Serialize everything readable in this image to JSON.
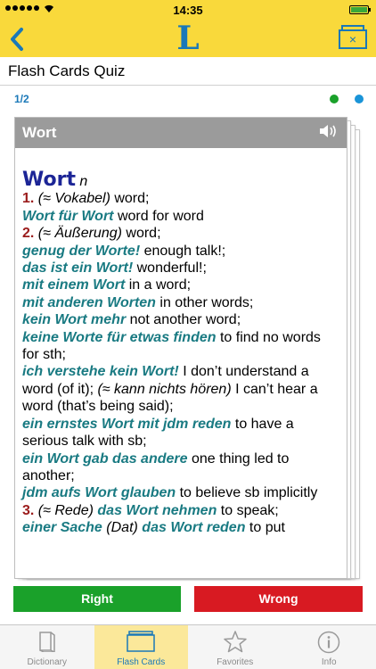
{
  "status": {
    "time": "14:35",
    "wifi_icon": "wifi-icon"
  },
  "nav": {
    "back_icon": "back-chevron-icon",
    "logo": "L",
    "card_icon": "flashcard-box-icon",
    "card_glyph": "×"
  },
  "title": "Flash Cards Quiz",
  "pager": {
    "label": "1/2",
    "dot_colors": [
      "#1aa12a",
      "#1a94d8"
    ]
  },
  "card": {
    "header_word": "Wort",
    "speaker_icon": "speaker-icon",
    "speaker_glyph": "🔊",
    "entry": {
      "headword": "Wort",
      "pos": "n",
      "s1_num": "1.",
      "s1_label": "(≈ Vokabel)",
      "s1_trans": " word;",
      "p1": "Wort für Wort",
      "p1_trans": " word for word",
      "s2_num": "2.",
      "s2_label": "(≈ Äußerung)",
      "s2_trans": " word;",
      "p2": "genug der Worte!",
      "p2_trans": " enough talk!;",
      "p3": "das ist ein Wort!",
      "p3_trans": " wonderful!;",
      "p4": "mit einem Wort",
      "p4_trans": " in a word;",
      "p5": "mit anderen Worten",
      "p5_trans": " in other words;",
      "p6": "kein Wort mehr",
      "p6_trans": " not another word;",
      "p7": "keine Worte für etwas finden",
      "p7_trans": " to find no words for sth;",
      "p8": "ich verstehe kein Wort!",
      "p8_trans": " I don’t understand a word (of it); ",
      "p8_label": "(≈ kann nichts hören)",
      "p8_trans2": " I can’t hear a word (that’s being said);",
      "p9": "ein ernstes Wort mit jdm reden",
      "p9_trans": " to have a serious talk with sb;",
      "p10": "ein Wort gab das andere",
      "p10_trans": " one thing led to another;",
      "p11": "jdm aufs Wort glauben",
      "p11_trans": " to believe sb implicitly",
      "s3_num": "3.",
      "s3_label": "(≈ Rede)",
      "p12": "das Wort nehmen",
      "p12_trans": " to speak;",
      "p13": "einer Sache",
      "p13_label": "(Dat)",
      "p14": "das Wort reden",
      "p14_trans": " to put"
    }
  },
  "buttons": {
    "right": "Right",
    "wrong": "Wrong"
  },
  "tabs": [
    {
      "label": "Dictionary",
      "icon": "dictionary-book-icon"
    },
    {
      "label": "Flash Cards",
      "icon": "flash-cards-icon"
    },
    {
      "label": "Favorites",
      "icon": "star-icon"
    },
    {
      "label": "Info",
      "icon": "info-icon"
    }
  ],
  "colors": {
    "brand_yellow": "#f9d93b",
    "accent_blue": "#1a78b8",
    "right_green": "#1aa12a",
    "wrong_red": "#d81a22",
    "phrase_teal": "#197a82",
    "headword_navy": "#1c2596",
    "sense_number_red": "#9b1c1c"
  }
}
